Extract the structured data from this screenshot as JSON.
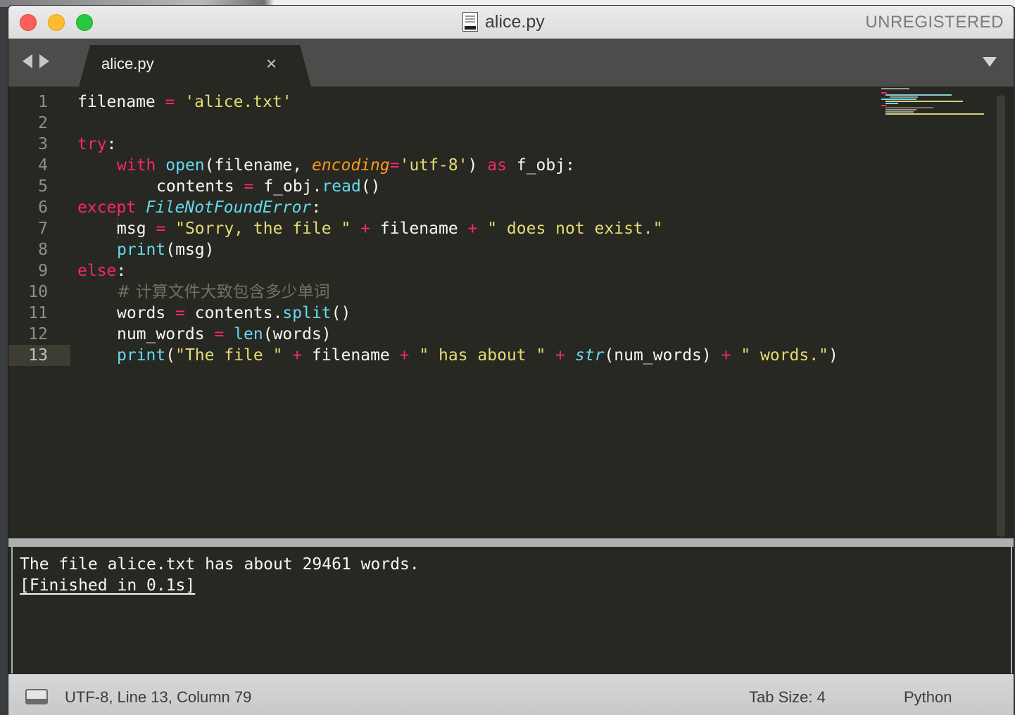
{
  "window": {
    "title": "alice.py",
    "registration": "UNREGISTERED",
    "file_icon": "python-file-icon"
  },
  "tabs": [
    {
      "label": "alice.py",
      "close_glyph": "×"
    }
  ],
  "editor": {
    "current_line": 13,
    "lines": [
      {
        "num": "1"
      },
      {
        "num": "2"
      },
      {
        "num": "3"
      },
      {
        "num": "4"
      },
      {
        "num": "5"
      },
      {
        "num": "6"
      },
      {
        "num": "7"
      },
      {
        "num": "8"
      },
      {
        "num": "9"
      },
      {
        "num": "10"
      },
      {
        "num": "11"
      },
      {
        "num": "12"
      },
      {
        "num": "13"
      }
    ],
    "code": {
      "l1": [
        "filename",
        " = ",
        "'alice.txt'"
      ],
      "l3": [
        "try",
        ":"
      ],
      "l4": [
        "with",
        " ",
        "open",
        "(filename, ",
        "encoding",
        "=",
        "'utf-8'",
        ") ",
        "as",
        " f_obj:"
      ],
      "l5": [
        "contents",
        " = ",
        "f_obj.",
        "read",
        "()"
      ],
      "l6": [
        "except",
        " ",
        "FileNotFoundError",
        ":"
      ],
      "l7": [
        "msg",
        " = ",
        "\"Sorry, the file \"",
        " + ",
        "filename",
        " + ",
        "\" does not exist.\""
      ],
      "l8": [
        "print",
        "(msg)"
      ],
      "l9": [
        "else",
        ":"
      ],
      "l10": [
        "# 计算文件大致包含多少单词"
      ],
      "l11": [
        "words",
        " = ",
        "contents.",
        "split",
        "()"
      ],
      "l12": [
        "num_words",
        " = ",
        "len",
        "(words)"
      ],
      "l13": [
        "print",
        "(",
        "\"The file \"",
        " + ",
        "filename",
        " + ",
        "\" has about \"",
        " + ",
        "str",
        "(num_words) ",
        "+",
        " ",
        "\" words.\"",
        ")"
      ]
    }
  },
  "output": {
    "lines": [
      "The file alice.txt has about 29461 words.",
      "[Finished in 0.1s]"
    ]
  },
  "statusbar": {
    "panel_icon": "panel-toggle-icon",
    "position": "UTF-8, Line 13, Column 79",
    "tab_size": "Tab Size: 4",
    "syntax": "Python"
  },
  "colors": {
    "keyword": "#f92672",
    "string": "#e6db74",
    "function": "#66d9ef",
    "param": "#fd971f",
    "comment": "#75715e",
    "background": "#272822"
  }
}
